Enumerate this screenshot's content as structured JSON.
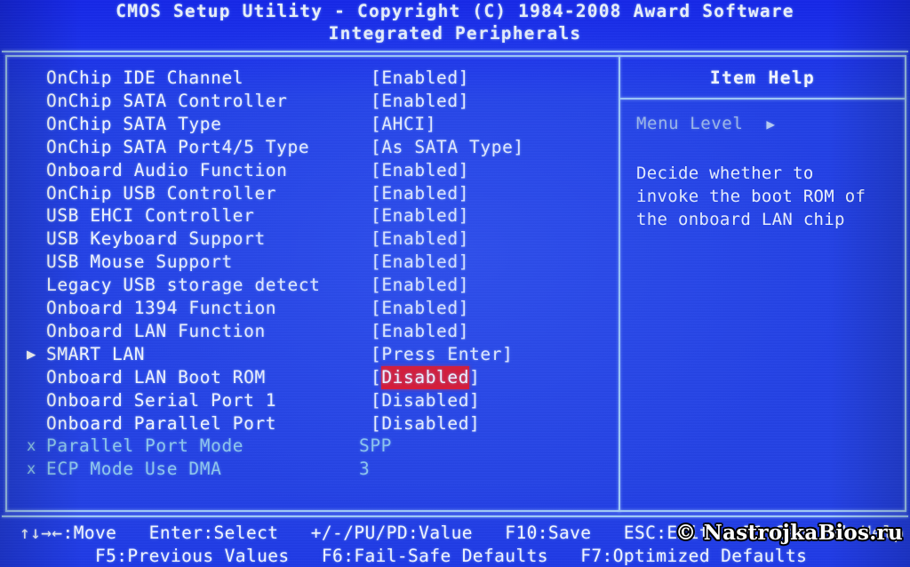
{
  "header": {
    "title": "CMOS Setup Utility - Copyright (C) 1984-2008 Award Software",
    "subtitle": "Integrated Peripherals"
  },
  "settings": [
    {
      "marker": "",
      "label": "OnChip IDE Channel",
      "value": "[Enabled]",
      "dim": false,
      "highlighted": false
    },
    {
      "marker": "",
      "label": "OnChip SATA Controller",
      "value": "[Enabled]",
      "dim": false,
      "highlighted": false
    },
    {
      "marker": "",
      "label": "OnChip SATA Type",
      "value": "[AHCI]",
      "dim": false,
      "highlighted": false
    },
    {
      "marker": "",
      "label": "OnChip SATA Port4/5 Type",
      "value": "[As SATA Type]",
      "dim": false,
      "highlighted": false
    },
    {
      "marker": "",
      "label": "Onboard Audio Function",
      "value": "[Enabled]",
      "dim": false,
      "highlighted": false
    },
    {
      "marker": "",
      "label": "OnChip USB Controller",
      "value": "[Enabled]",
      "dim": false,
      "highlighted": false
    },
    {
      "marker": "",
      "label": "USB EHCI Controller",
      "value": "[Enabled]",
      "dim": false,
      "highlighted": false
    },
    {
      "marker": "",
      "label": "USB Keyboard Support",
      "value": "[Enabled]",
      "dim": false,
      "highlighted": false
    },
    {
      "marker": "",
      "label": "USB Mouse Support",
      "value": "[Enabled]",
      "dim": false,
      "highlighted": false
    },
    {
      "marker": "",
      "label": "Legacy USB storage detect",
      "value": "[Enabled]",
      "dim": false,
      "highlighted": false
    },
    {
      "marker": "",
      "label": "Onboard 1394 Function",
      "value": "[Enabled]",
      "dim": false,
      "highlighted": false
    },
    {
      "marker": "",
      "label": "Onboard LAN Function",
      "value": "[Enabled]",
      "dim": false,
      "highlighted": false
    },
    {
      "marker": "▶",
      "label": "SMART LAN",
      "value": "[Press Enter]",
      "dim": false,
      "highlighted": false
    },
    {
      "marker": "",
      "label": "Onboard LAN Boot ROM",
      "value": "[Disabled]",
      "dim": false,
      "highlighted": true
    },
    {
      "marker": "",
      "label": "Onboard Serial Port 1",
      "value": "[Disabled]",
      "dim": false,
      "highlighted": false
    },
    {
      "marker": "",
      "label": "Onboard Parallel Port",
      "value": "[Disabled]",
      "dim": false,
      "highlighted": false
    },
    {
      "marker": "x",
      "label": "Parallel Port Mode",
      "value": "SPP",
      "dim": true,
      "highlighted": false
    },
    {
      "marker": "x",
      "label": "ECP Mode Use DMA",
      "value": "3",
      "dim": true,
      "highlighted": false
    }
  ],
  "item_help": {
    "title": "Item Help",
    "menu_level_label": "Menu Level",
    "menu_level_arrow": "▶",
    "description_lines": [
      "Decide whether to",
      "invoke the boot ROM of",
      "the onboard LAN chip"
    ]
  },
  "footer": {
    "line1": "↑↓→←:Move   Enter:Select   +/-/PU/PD:Value   F10:Save   ESC:Exit   F1:General Help",
    "line2": "       F5:Previous Values   F6:Fail-Safe Defaults   F7:Optimized Defaults"
  },
  "watermark": {
    "text": "© NastrojkaBios.ru"
  },
  "colors": {
    "background_blue": "#2240e6",
    "frame_line": "#9fc8f5",
    "text_white": "#f0f4fc",
    "text_dim": "#8ec6ec",
    "highlight_red": "#e31122",
    "help_label": "#9fb9e8"
  }
}
